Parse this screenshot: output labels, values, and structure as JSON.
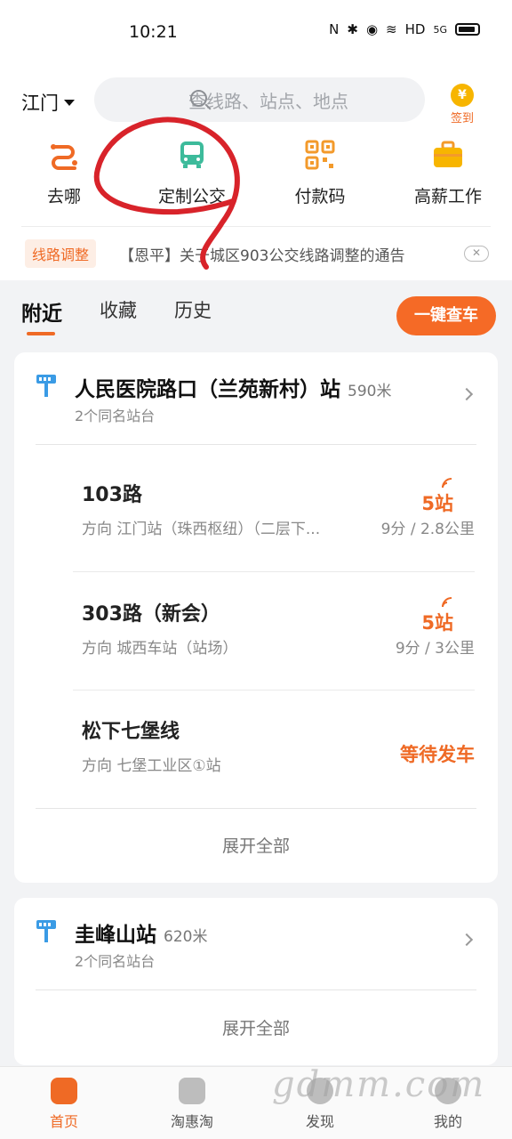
{
  "status": {
    "time": "10:21",
    "network": "HD",
    "signal": "5G"
  },
  "header": {
    "city": "江门",
    "search_placeholder": "查线路、站点、地点",
    "checkin_label": "签到",
    "checkin_coin": "¥"
  },
  "quick_actions": [
    {
      "label": "去哪",
      "icon": "route-icon"
    },
    {
      "label": "定制公交",
      "icon": "bus-icon"
    },
    {
      "label": "付款码",
      "icon": "qrcode-icon"
    },
    {
      "label": "高薪工作",
      "icon": "briefcase-icon"
    }
  ],
  "notice": {
    "tag": "线路调整",
    "text": "【恩平】关于城区903公交线路调整的通告",
    "close": "✕"
  },
  "tabs": [
    "附近",
    "收藏",
    "历史"
  ],
  "check_button": "一键查车",
  "stops": [
    {
      "name": "人民医院路口（兰苑新村）站",
      "distance": "590米",
      "sub": "2个同名站台",
      "routes": [
        {
          "name": "103路",
          "direction": "方向 江门站（珠西枢纽）（二层下...",
          "status": "5站",
          "time": "9分 / 2.8公里"
        },
        {
          "name": "303路（新会）",
          "direction": "方向 城西车站（站场）",
          "status": "5站",
          "time": "9分 / 3公里"
        },
        {
          "name": "松下七堡线",
          "direction": "方向 七堡工业区①站",
          "status": "等待发车",
          "time": ""
        }
      ],
      "expand": "展开全部"
    },
    {
      "name": "圭峰山站",
      "distance": "620米",
      "sub": "2个同名站台",
      "expand": "展开全部"
    }
  ],
  "bottom_nav": [
    {
      "label": "首页",
      "icon": "home-icon"
    },
    {
      "label": "淘惠淘",
      "icon": "shopping-bag-icon"
    },
    {
      "label": "发现",
      "icon": "discover-icon"
    },
    {
      "label": "我的",
      "icon": "profile-icon"
    }
  ],
  "watermark": "gdmm.com",
  "colors": {
    "accent": "#ef6a25",
    "bus_green": "#3dbb9b",
    "qr_orange": "#f39a2b",
    "briefcase": "#f7b500"
  }
}
